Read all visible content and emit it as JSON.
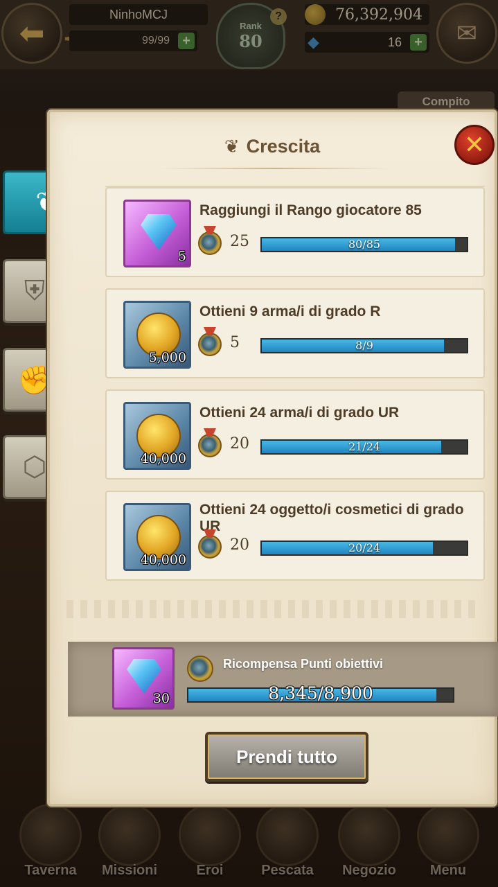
{
  "header": {
    "player_name": "NinhoMCJ",
    "stamina": "99/99",
    "rank_label": "Rank",
    "rank_value": "80",
    "gold": "76,392,904",
    "gems": "16"
  },
  "background": {
    "compito_tab": "Compito"
  },
  "panel": {
    "title": "Crescita",
    "side_tabs": [
      "growth",
      "shield",
      "fist",
      "hexagon"
    ],
    "quests": [
      {
        "text": "Raggiungi il Rango giocatore 85",
        "reward_type": "gem",
        "reward_qty": "5",
        "points": "25",
        "progress": "80/85",
        "fraction": 0.9412
      },
      {
        "text": "Ottieni 9 arma/i di grado R",
        "reward_type": "coin",
        "reward_qty": "5,000",
        "points": "5",
        "progress": "8/9",
        "fraction": 0.8889
      },
      {
        "text": "Ottieni 24 arma/i di grado UR",
        "reward_type": "coin",
        "reward_qty": "40,000",
        "points": "20",
        "progress": "21/24",
        "fraction": 0.875
      },
      {
        "text": "Ottieni 24 oggetto/i cosmetici di grado UR",
        "reward_type": "coin",
        "reward_qty": "40,000",
        "points": "20",
        "progress": "20/24",
        "fraction": 0.8333
      }
    ],
    "goal": {
      "label": "Ricompensa Punti obiettivi",
      "reward_qty": "30",
      "progress": "8,345/8,900",
      "fraction": 0.9376
    },
    "claim_button": "Prendi tutto"
  },
  "nav": {
    "items": [
      "Taverna",
      "Missioni",
      "Eroi",
      "Pescata",
      "Negozio",
      "Menu"
    ]
  },
  "colors": {
    "accent_teal": "#1f9fb4",
    "progress_blue": "#2c9bd4",
    "close_red": "#c2301e",
    "title_brown": "#6a5234"
  }
}
